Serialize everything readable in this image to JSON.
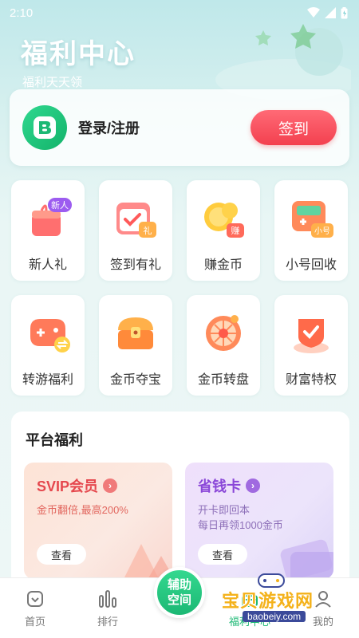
{
  "status_bar": {
    "time": "2:10"
  },
  "header": {
    "title": "福利中心",
    "subtitle": "福利天天领"
  },
  "login_card": {
    "label": "登录/注册",
    "signin_button": "签到"
  },
  "grid": {
    "items": [
      {
        "label": "新人礼",
        "badge": "新人",
        "icon": "gift-bag-icon"
      },
      {
        "label": "签到有礼",
        "badge": "礼",
        "icon": "calendar-check-icon"
      },
      {
        "label": "赚金币",
        "badge": "赚",
        "icon": "coins-icon"
      },
      {
        "label": "小号回收",
        "badge": "小号",
        "icon": "gamepad-recycle-icon"
      },
      {
        "label": "转游福利",
        "icon": "gamepad-transfer-icon"
      },
      {
        "label": "金币夺宝",
        "icon": "treasure-chest-icon"
      },
      {
        "label": "金币转盘",
        "icon": "wheel-icon"
      },
      {
        "label": "财富特权",
        "icon": "wealth-shield-icon"
      }
    ]
  },
  "platform": {
    "title": "平台福利",
    "cards": [
      {
        "title": "SVIP会员",
        "desc_lines": [
          "金币翻倍,最高200%"
        ],
        "button": "查看"
      },
      {
        "title": "省钱卡",
        "desc_lines": [
          "开卡即回本",
          "每日再领1000金币"
        ],
        "button": "查看"
      }
    ]
  },
  "tab_bar": {
    "items": [
      {
        "label": "首页",
        "icon": "home-icon"
      },
      {
        "label": "排行",
        "icon": "ranking-icon"
      },
      {
        "label": "辅助空间",
        "icon": ""
      },
      {
        "label": "福利中心",
        "icon": "gift-icon"
      },
      {
        "label": "我的",
        "icon": "user-icon"
      }
    ],
    "center_lines": [
      "辅助",
      "空间"
    ]
  },
  "watermark": {
    "text": "宝贝游戏网",
    "url": "baobeiy.com"
  },
  "colors": {
    "accent": "#f3404f",
    "brand_green": "#1cb874",
    "svip": "#e5474d",
    "save_card": "#8a47d8"
  }
}
